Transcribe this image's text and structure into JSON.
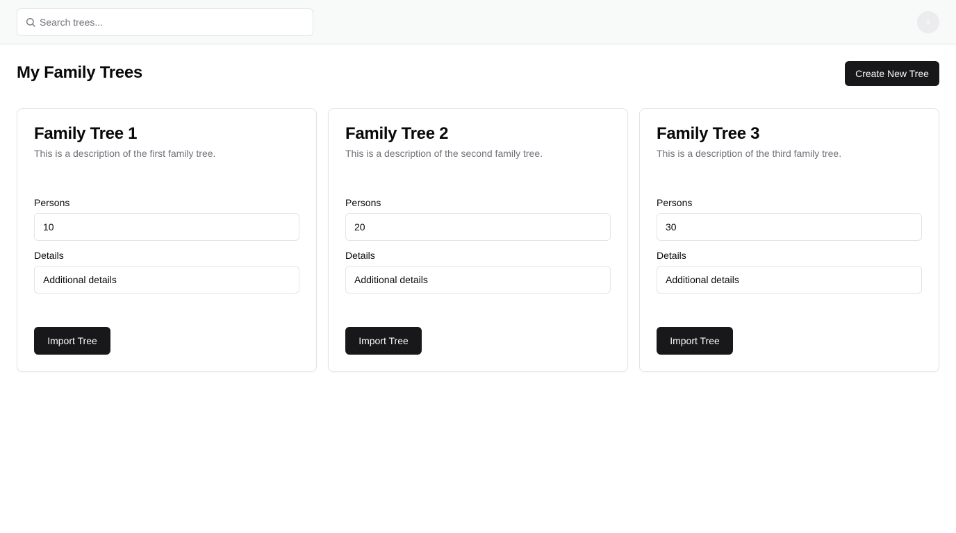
{
  "header": {
    "search": {
      "placeholder": "Search trees...",
      "value": ""
    },
    "avatar_icon": "user-avatar"
  },
  "page": {
    "title": "My Family Trees",
    "create_label": "Create New Tree"
  },
  "trees": [
    {
      "title": "Family Tree 1",
      "description": "This is a description of the first family tree.",
      "persons_label": "Persons",
      "persons_value": "10",
      "details_label": "Details",
      "details_value": "Additional details",
      "import_label": "Import Tree"
    },
    {
      "title": "Family Tree 2",
      "description": "This is a description of the second family tree.",
      "persons_label": "Persons",
      "persons_value": "20",
      "details_label": "Details",
      "details_value": "Additional details",
      "import_label": "Import Tree"
    },
    {
      "title": "Family Tree 3",
      "description": "This is a description of the third family tree.",
      "persons_label": "Persons",
      "persons_value": "30",
      "details_label": "Details",
      "details_value": "Additional details",
      "import_label": "Import Tree"
    }
  ],
  "colors": {
    "primary": "#18181b",
    "muted_text": "#71717a",
    "border": "#e4e4e7",
    "header_bg": "#f8f9f9"
  }
}
